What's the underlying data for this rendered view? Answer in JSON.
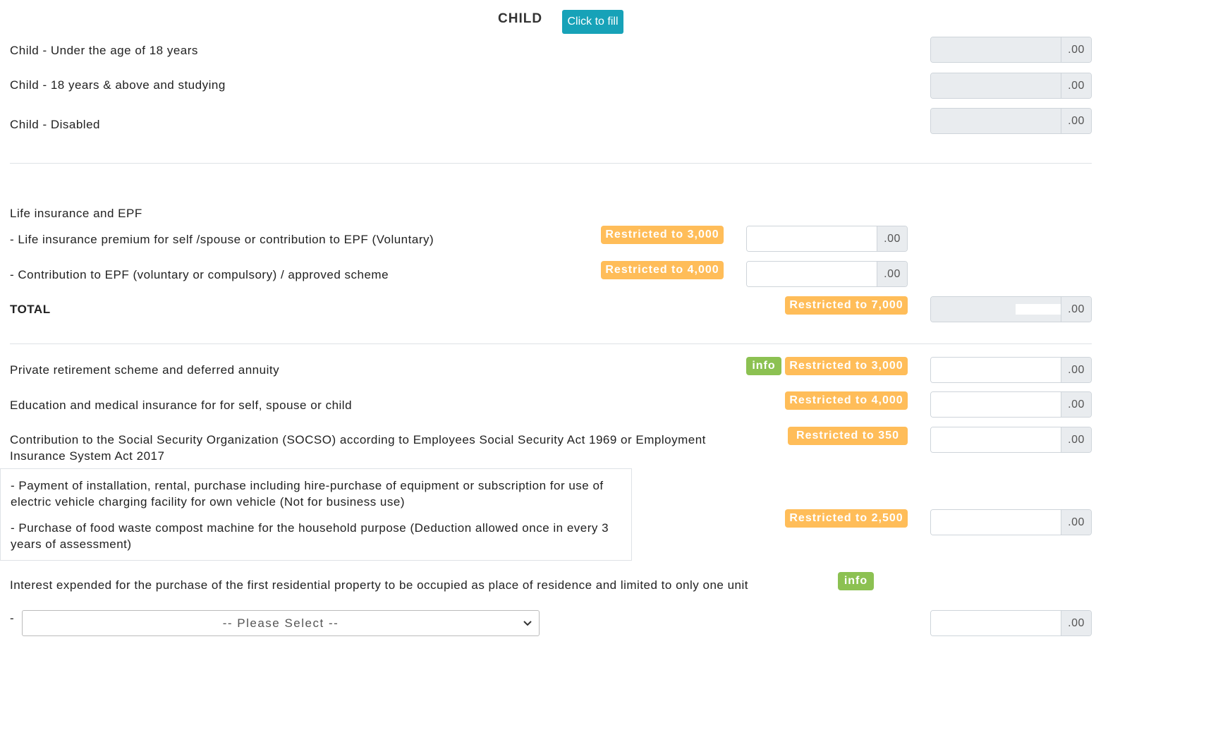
{
  "child": {
    "title": "CHILD",
    "fill_button": "Click to fill",
    "rows": [
      {
        "label": "Child - Under the age of 18 years",
        "suffix": ".00"
      },
      {
        "label": "Child - 18 years & above and studying",
        "suffix": ".00"
      },
      {
        "label": "Child - Disabled",
        "suffix": ".00"
      }
    ]
  },
  "life": {
    "heading": "Life insurance and EPF",
    "items": [
      {
        "label": "- Life insurance premium for self /spouse or contribution to EPF (Voluntary)",
        "badge": "Restricted to 3,000",
        "suffix": ".00"
      },
      {
        "label": "- Contribution to EPF (voluntary or compulsory) / approved scheme",
        "badge": "Restricted to 4,000",
        "suffix": ".00"
      }
    ],
    "total": {
      "label": "TOTAL",
      "badge": "Restricted to 7,000",
      "suffix": ".00"
    }
  },
  "other": {
    "private_retirement": {
      "label": "Private retirement scheme and deferred annuity",
      "info": "info",
      "badge": "Restricted to 3,000",
      "suffix": ".00"
    },
    "education_medical": {
      "label": "Education and medical insurance for for self, spouse or child",
      "badge": "Restricted to 4,000",
      "suffix": ".00"
    },
    "socso": {
      "label_line1": "Contribution to the Social Security Organization (SOCSO) according to Employees Social Security Act 1969 or Employment",
      "label_line2": "Insurance System Act 2017",
      "badge": "Restricted to 350",
      "suffix": ".00"
    },
    "ev_compost": {
      "ev_line1": "- Payment of installation, rental, purchase including hire-purchase of equipment or subscription for use of",
      "ev_line2": "electric vehicle charging facility for own vehicle (Not for business use)",
      "compost_line1": "- Purchase of food waste compost machine for the household purpose (Deduction allowed once in every 3",
      "compost_line2": "years of assessment)",
      "badge": "Restricted to 2,500",
      "suffix": ".00"
    },
    "housing_interest": {
      "label": "Interest expended for the purchase of the first residential property to be occupied as place of residence and limited to only one unit",
      "info": "info",
      "dash": "-",
      "select_placeholder": "-- Please Select --",
      "suffix": ".00"
    }
  },
  "icons": {
    "select_arrow": "chevron-down-icon"
  }
}
